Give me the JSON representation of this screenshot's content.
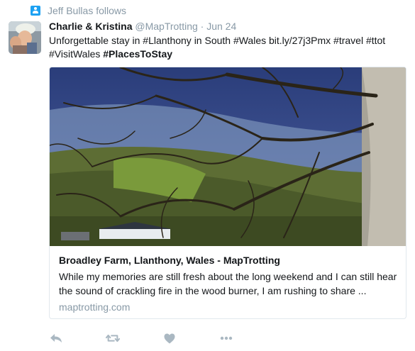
{
  "context": {
    "text": "Jeff Bullas follows"
  },
  "tweet": {
    "name": "Charlie & Kristina",
    "handle": "@MapTrotting",
    "separator": "·",
    "time": "Jun 24",
    "text_segments": [
      "Unforgettable stay in #Llanthony in South #Wales bit.ly/27j3Pmx #travel #ttot",
      "#VisitWales",
      "#PlacesToStay"
    ]
  },
  "card": {
    "title": "Broadley Farm, Llanthony, Wales - MapTrotting",
    "description": "While my memories are still fresh about the long weekend and I can still hear the sound of crackling fire in the wood burner, I am rushing to share ...",
    "domain": "maptrotting.com"
  },
  "actions": [
    {
      "icon": "reply-icon"
    },
    {
      "icon": "retweet-icon"
    },
    {
      "icon": "heart-icon"
    },
    {
      "icon": "more-icon"
    }
  ],
  "colors": {
    "accent": "#1da1f2",
    "muted": "#8899a6",
    "border": "#e1e8ed",
    "icon": "#aab8c2"
  }
}
